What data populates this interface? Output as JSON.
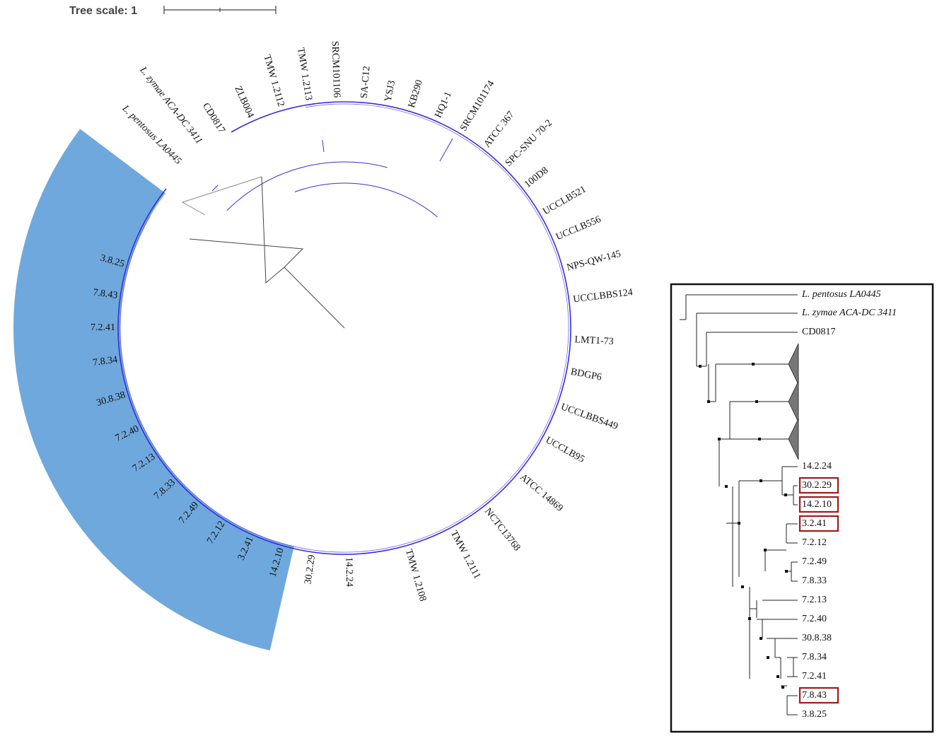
{
  "tree_scale": {
    "label": "Tree scale: 1"
  },
  "circular_tree": {
    "outgroup_leaves": [
      {
        "label": "L. pentosus LA0445",
        "italic": true
      },
      {
        "label": "L. zymae ACA-DC 3411",
        "italic": true
      }
    ],
    "reference_leaves": [
      "CD0817",
      "ZLB004",
      "TMW 1.2112",
      "TMW 1.2113",
      "SRCM101106",
      "SA-C12",
      "YSJ3",
      "KB290",
      "HQ1-1",
      "SRCM101174",
      "ATCC 367",
      "SPC-SNU 70-2",
      "100D8",
      "UCCLB521",
      "UCCLB556",
      "NPS-QW-145",
      "UCCLBBS124",
      "LMT1-73",
      "BDGP6",
      "UCCLBBS449",
      "UCCLB95",
      "ATCC 14869",
      "NCTC13768",
      "TMW 1.2111",
      "TMW 1.2108"
    ],
    "isolate_leaves": [
      "14.2.24",
      "30.2.29",
      "14.2.10",
      "3.2.41",
      "7.2.12",
      "7.2.49",
      "7.8.33",
      "7.2.13",
      "7.2.40",
      "30.8.38",
      "7.8.34",
      "7.2.41",
      "7.8.43",
      "3.8.25"
    ],
    "colors": {
      "clade_branch": "#3a2ee0",
      "outgroup_branch": "#888888",
      "isolate_highlight": "#6fa8dc",
      "root_branch": "#444444"
    }
  },
  "inset_tree": {
    "top_leaves": [
      {
        "label": "L. pentosus LA0445",
        "italic": true
      },
      {
        "label": "L. zymae ACA-DC 3411",
        "italic": true
      },
      {
        "label": "CD0817",
        "italic": false
      }
    ],
    "collapsed_clades": 3,
    "isolate_leaves": [
      {
        "label": "14.2.24",
        "boxed": false
      },
      {
        "label": "30.2.29",
        "boxed": true
      },
      {
        "label": "14.2.10",
        "boxed": true
      },
      {
        "label": "3.2.41",
        "boxed": true
      },
      {
        "label": "7.2.12",
        "boxed": false
      },
      {
        "label": "7.2.49",
        "boxed": false
      },
      {
        "label": "7.8.33",
        "boxed": false
      },
      {
        "label": "7.2.13",
        "boxed": false
      },
      {
        "label": "7.2.40",
        "boxed": false
      },
      {
        "label": "30.8.38",
        "boxed": false
      },
      {
        "label": "7.8.34",
        "boxed": false
      },
      {
        "label": "7.2.41",
        "boxed": false
      },
      {
        "label": "7.8.43",
        "boxed": true
      },
      {
        "label": "3.8.25",
        "boxed": false
      }
    ],
    "colors": {
      "box": "#a11a1a",
      "collapsed": "#777777",
      "frame": "#111111"
    }
  }
}
